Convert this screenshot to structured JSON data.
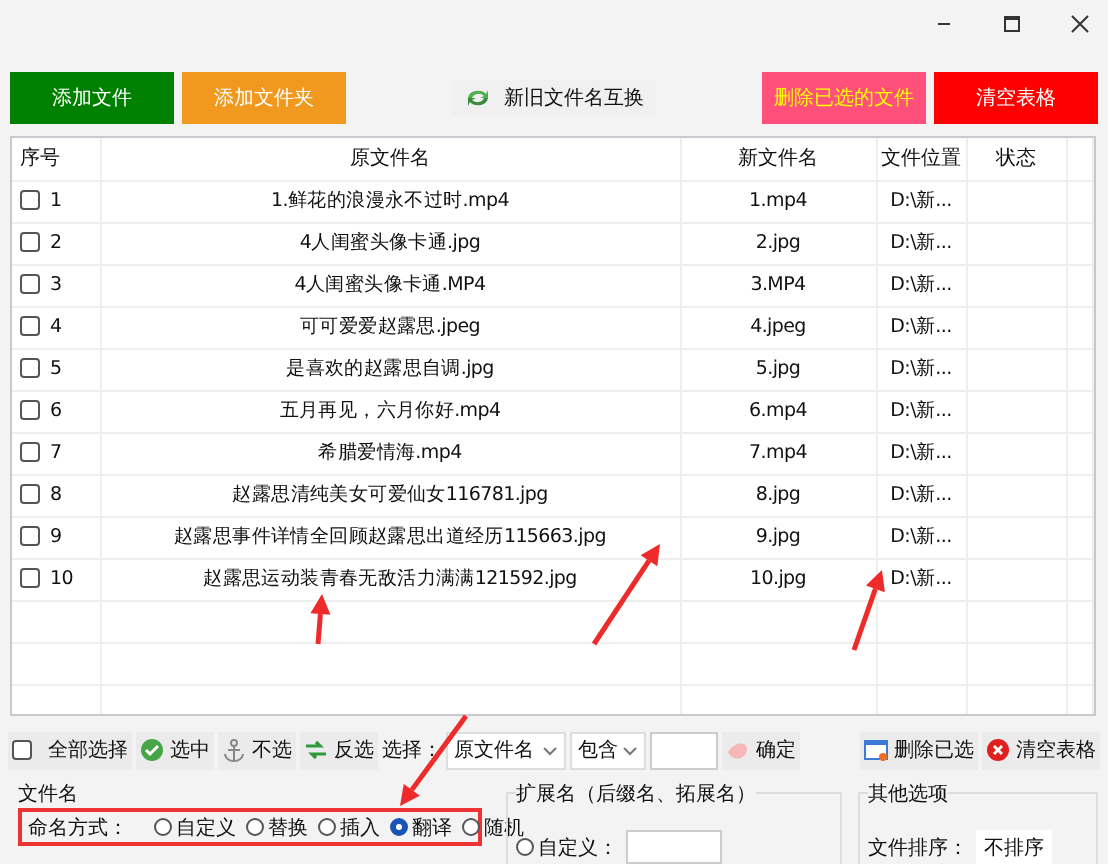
{
  "top_buttons": [
    {
      "label": "添加文件",
      "kind": "plain",
      "color": "#008000"
    },
    {
      "label": "添加文件夹",
      "kind": "plain",
      "color": "#f0991e"
    },
    {
      "label": "新旧文件名互换",
      "kind": "swap",
      "color": "#f0f0f0"
    },
    {
      "label": "删除已选的文件",
      "kind": "plain",
      "color": "#ff4f7b"
    },
    {
      "label": "清空表格",
      "kind": "plain",
      "color": "#ff0000"
    }
  ],
  "table": {
    "columns": [
      "序号",
      "原文件名",
      "新文件名",
      "文件位置",
      "状态"
    ],
    "rows": [
      {
        "index": "1",
        "checked": false,
        "original": "1.鲜花的浪漫永不过时.mp4",
        "new": "1.mp4",
        "location": "D:\\新..."
      },
      {
        "index": "2",
        "checked": false,
        "original": "4人闺蜜头像卡通.jpg",
        "new": "2.jpg",
        "location": "D:\\新..."
      },
      {
        "index": "3",
        "checked": false,
        "original": "4人闺蜜头像卡通.MP4",
        "new": "3.MP4",
        "location": "D:\\新..."
      },
      {
        "index": "4",
        "checked": false,
        "original": "可可爱爱赵露思.jpeg",
        "new": "4.jpeg",
        "location": "D:\\新..."
      },
      {
        "index": "5",
        "checked": false,
        "original": "是喜欢的赵露思自调.jpg",
        "new": "5.jpg",
        "location": "D:\\新..."
      },
      {
        "index": "6",
        "checked": false,
        "original": "五月再见，六月你好.mp4",
        "new": "6.mp4",
        "location": "D:\\新..."
      },
      {
        "index": "7",
        "checked": false,
        "original": "希腊爱情海.mp4",
        "new": "7.mp4",
        "location": "D:\\新..."
      },
      {
        "index": "8",
        "checked": false,
        "original": "赵露思清纯美女可爱仙女116781.jpg",
        "new": "8.jpg",
        "location": "D:\\新..."
      },
      {
        "index": "9",
        "checked": false,
        "original": "赵露思事件详情全回顾赵露思出道经历115663.jpg",
        "new": "9.jpg",
        "location": "D:\\新..."
      },
      {
        "index": "10",
        "checked": false,
        "original": "赵露思运动装青春无敌活力满满121592.jpg",
        "new": "10.jpg",
        "location": "D:\\新..."
      }
    ]
  },
  "selection_bar": {
    "select_all": {
      "label": "全部选择",
      "checked": false
    },
    "buttons": [
      {
        "label": "选中",
        "kind": "check"
      },
      {
        "label": "不选",
        "kind": "anchor"
      },
      {
        "label": "反选",
        "kind": "invert"
      }
    ],
    "filter_label": "选择：",
    "dropdowns": [
      "原文件名",
      "包含"
    ],
    "confirm": "确定",
    "actions": [
      {
        "label": "删除已选",
        "kind": "delete"
      },
      {
        "label": "清空表格",
        "kind": "clear"
      }
    ]
  },
  "filename_group": {
    "title": "文件名",
    "naming_label": "命名方式：",
    "options": [
      {
        "label": "自定义",
        "selected": false
      },
      {
        "label": "替换",
        "selected": false
      },
      {
        "label": "插入",
        "selected": false
      },
      {
        "label": "翻译",
        "selected": true
      },
      {
        "label": "随机",
        "selected": false
      }
    ]
  },
  "extension_group": {
    "title": "扩展名（后缀名、拓展名）",
    "custom": {
      "label": "自定义：",
      "selected": false
    }
  },
  "other_group": {
    "title": "其他选项",
    "sort_label": "文件排序：",
    "sort_value": "不排序"
  }
}
